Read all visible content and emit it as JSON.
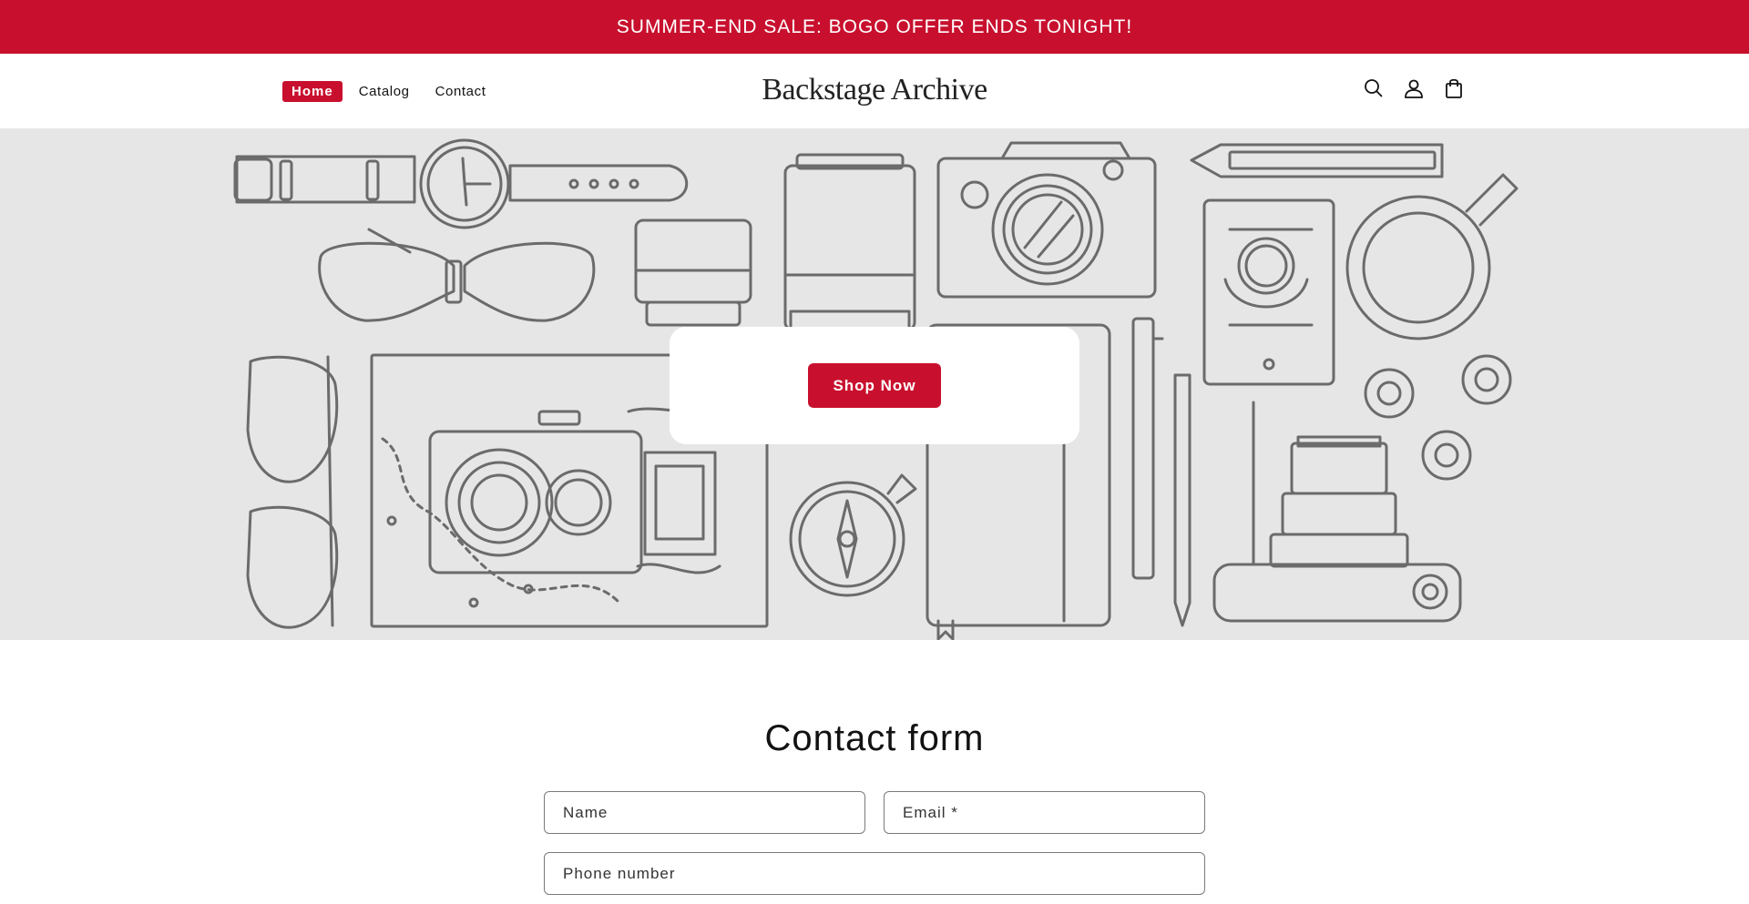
{
  "announcement": {
    "text": "SUMMER-END SALE: BOGO OFFER ENDS TONIGHT!"
  },
  "nav": {
    "items": [
      {
        "label": "Home",
        "active": true
      },
      {
        "label": "Catalog",
        "active": false
      },
      {
        "label": "Contact",
        "active": false
      }
    ]
  },
  "brand": {
    "name": "Backstage Archive"
  },
  "header_icons": [
    "search-icon",
    "account-icon",
    "cart-icon"
  ],
  "hero": {
    "button_label": "Shop Now"
  },
  "contact_form": {
    "title": "Contact form",
    "name_placeholder": "Name",
    "email_placeholder": "Email *",
    "phone_placeholder": "Phone number"
  },
  "colors": {
    "accent": "#c8102e",
    "hero_background": "#e6e6e6",
    "line_art": "#6b6b6b"
  }
}
